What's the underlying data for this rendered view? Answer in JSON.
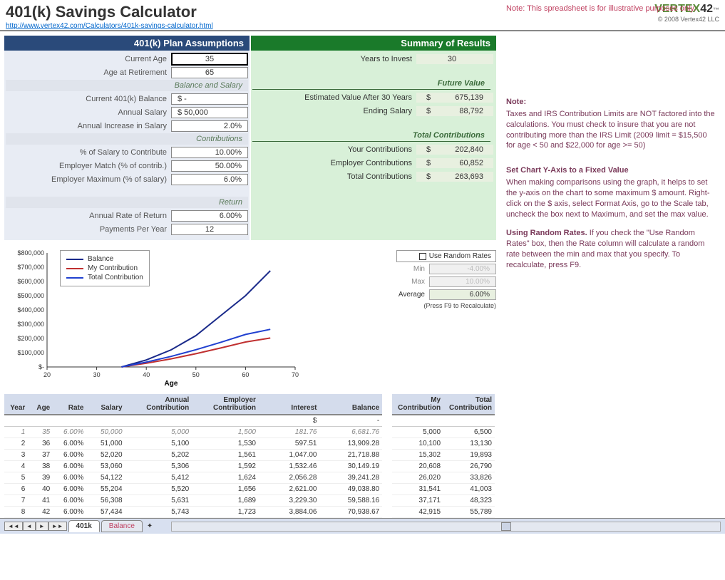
{
  "header": {
    "title": "401(k) Savings Calculator",
    "url": "http://www.vertex42.com/Calculators/401k-savings-calculator.html",
    "logo_prefix": "VERTEX",
    "logo_suffix": "42",
    "copyright": "© 2008 Vertex42 LLC",
    "top_note": "Note: This spreadsheet is for illustrative purposes only."
  },
  "assumptions": {
    "title": "401(k) Plan Assumptions",
    "rows": {
      "current_age": {
        "label": "Current Age",
        "value": "35"
      },
      "retire_age": {
        "label": "Age at Retirement",
        "value": "65"
      },
      "sub1": "Balance and Salary",
      "balance": {
        "label": "Current 401(k) Balance",
        "value": "$          -"
      },
      "salary": {
        "label": "Annual Salary",
        "value": "$     50,000"
      },
      "increase": {
        "label": "Annual Increase in Salary",
        "value": "2.0%"
      },
      "sub2": "Contributions",
      "pct_contrib": {
        "label": "% of Salary to Contribute",
        "value": "10.00%"
      },
      "emp_match": {
        "label": "Employer Match (% of contrib.)",
        "value": "50.00%"
      },
      "emp_max": {
        "label": "Employer Maximum (% of salary)",
        "value": "6.0%"
      },
      "sub3": "Return",
      "rate": {
        "label": "Annual Rate of Return",
        "value": "6.00%"
      },
      "payments": {
        "label": "Payments Per Year",
        "value": "12"
      }
    }
  },
  "summary": {
    "title": "Summary of Results",
    "rows": {
      "years": {
        "label": "Years to Invest",
        "value": "30"
      },
      "sub1": "Future Value",
      "est_value": {
        "label": "Estimated Value After 30 Years",
        "value": "675,139"
      },
      "end_salary": {
        "label": "Ending Salary",
        "value": "88,792"
      },
      "sub2": "Total Contributions",
      "your_contrib": {
        "label": "Your Contributions",
        "value": "202,840"
      },
      "emp_contrib": {
        "label": "Employer Contributions",
        "value": "60,852"
      },
      "total_contrib": {
        "label": "Total Contributions",
        "value": "263,693"
      }
    }
  },
  "rates": {
    "checkbox_label": "Use Random Rates",
    "min": {
      "label": "Min",
      "value": "-4.00%"
    },
    "max": {
      "label": "Max",
      "value": "10.00%"
    },
    "avg": {
      "label": "Average",
      "value": "6.00%"
    },
    "hint": "(Press F9 to Recalculate)"
  },
  "notes": {
    "h1": "Note:",
    "p1": "Taxes and IRS Contribution Limits are NOT factored into the calculations. You must check to insure that you are not contributing more than the IRS Limit (2009 limit = $15,500 for age < 50 and $22,000 for age >= 50)",
    "h2": "Set Chart Y-Axis to a Fixed Value",
    "p2": "When making comparisons using the graph, it helps to set the y-axis on the chart to some maximum $ amount. Right-click on the $ axis, select Format Axis, go to the Scale tab, uncheck the box next to Maximum, and set the max value.",
    "h3_bold": "Using Random Rates.",
    "p3": " If you check the \"Use Random Rates\" box, then the Rate column will calculate a random rate between the min and max that you specify. To recalculate, press F9."
  },
  "chart_data": {
    "type": "line",
    "xlabel": "Age",
    "x": [
      20,
      30,
      40,
      50,
      60,
      70
    ],
    "ylim": [
      0,
      800000
    ],
    "yticks": [
      "$-",
      "$100,000",
      "$200,000",
      "$300,000",
      "$400,000",
      "$500,000",
      "$600,000",
      "$700,000",
      "$800,000"
    ],
    "series": [
      {
        "name": "Balance",
        "color": "#1a2a8a",
        "points": [
          [
            35,
            0
          ],
          [
            40,
            49000
          ],
          [
            45,
            120000
          ],
          [
            50,
            220000
          ],
          [
            55,
            360000
          ],
          [
            60,
            500000
          ],
          [
            65,
            675000
          ]
        ]
      },
      {
        "name": "My Contribution",
        "color": "#c03030",
        "points": [
          [
            35,
            0
          ],
          [
            40,
            26000
          ],
          [
            45,
            57000
          ],
          [
            50,
            93000
          ],
          [
            55,
            133000
          ],
          [
            60,
            175000
          ],
          [
            65,
            203000
          ]
        ]
      },
      {
        "name": "Total Contribution",
        "color": "#2040d0",
        "points": [
          [
            35,
            0
          ],
          [
            40,
            34000
          ],
          [
            45,
            74000
          ],
          [
            50,
            121000
          ],
          [
            55,
            173000
          ],
          [
            60,
            228000
          ],
          [
            65,
            264000
          ]
        ]
      }
    ]
  },
  "table1": {
    "headers": [
      "Year",
      "Age",
      "Rate",
      "Salary",
      "Annual Contribution",
      "Employer Contribution",
      "Interest",
      "Balance"
    ],
    "init_row": [
      "",
      "",
      "",
      "",
      "",
      "",
      "$",
      "-"
    ],
    "rows": [
      [
        "1",
        "35",
        "6.00%",
        "50,000",
        "5,000",
        "1,500",
        "181.76",
        "6,681.76"
      ],
      [
        "2",
        "36",
        "6.00%",
        "51,000",
        "5,100",
        "1,530",
        "597.51",
        "13,909.28"
      ],
      [
        "3",
        "37",
        "6.00%",
        "52,020",
        "5,202",
        "1,561",
        "1,047.00",
        "21,718.88"
      ],
      [
        "4",
        "38",
        "6.00%",
        "53,060",
        "5,306",
        "1,592",
        "1,532.46",
        "30,149.19"
      ],
      [
        "5",
        "39",
        "6.00%",
        "54,122",
        "5,412",
        "1,624",
        "2,056.28",
        "39,241.28"
      ],
      [
        "6",
        "40",
        "6.00%",
        "55,204",
        "5,520",
        "1,656",
        "2,621.00",
        "49,038.80"
      ],
      [
        "7",
        "41",
        "6.00%",
        "56,308",
        "5,631",
        "1,689",
        "3,229.30",
        "59,588.16"
      ],
      [
        "8",
        "42",
        "6.00%",
        "57,434",
        "5,743",
        "1,723",
        "3,884.06",
        "70,938.67"
      ]
    ]
  },
  "table2": {
    "headers": [
      "My Contribution",
      "Total Contribution"
    ],
    "rows": [
      [
        "5,000",
        "6,500"
      ],
      [
        "10,100",
        "13,130"
      ],
      [
        "15,302",
        "19,893"
      ],
      [
        "20,608",
        "26,790"
      ],
      [
        "26,020",
        "33,826"
      ],
      [
        "31,541",
        "41,003"
      ],
      [
        "37,171",
        "48,323"
      ],
      [
        "42,915",
        "55,789"
      ]
    ]
  },
  "tabs": {
    "active": "401k",
    "inactive": "Balance"
  }
}
